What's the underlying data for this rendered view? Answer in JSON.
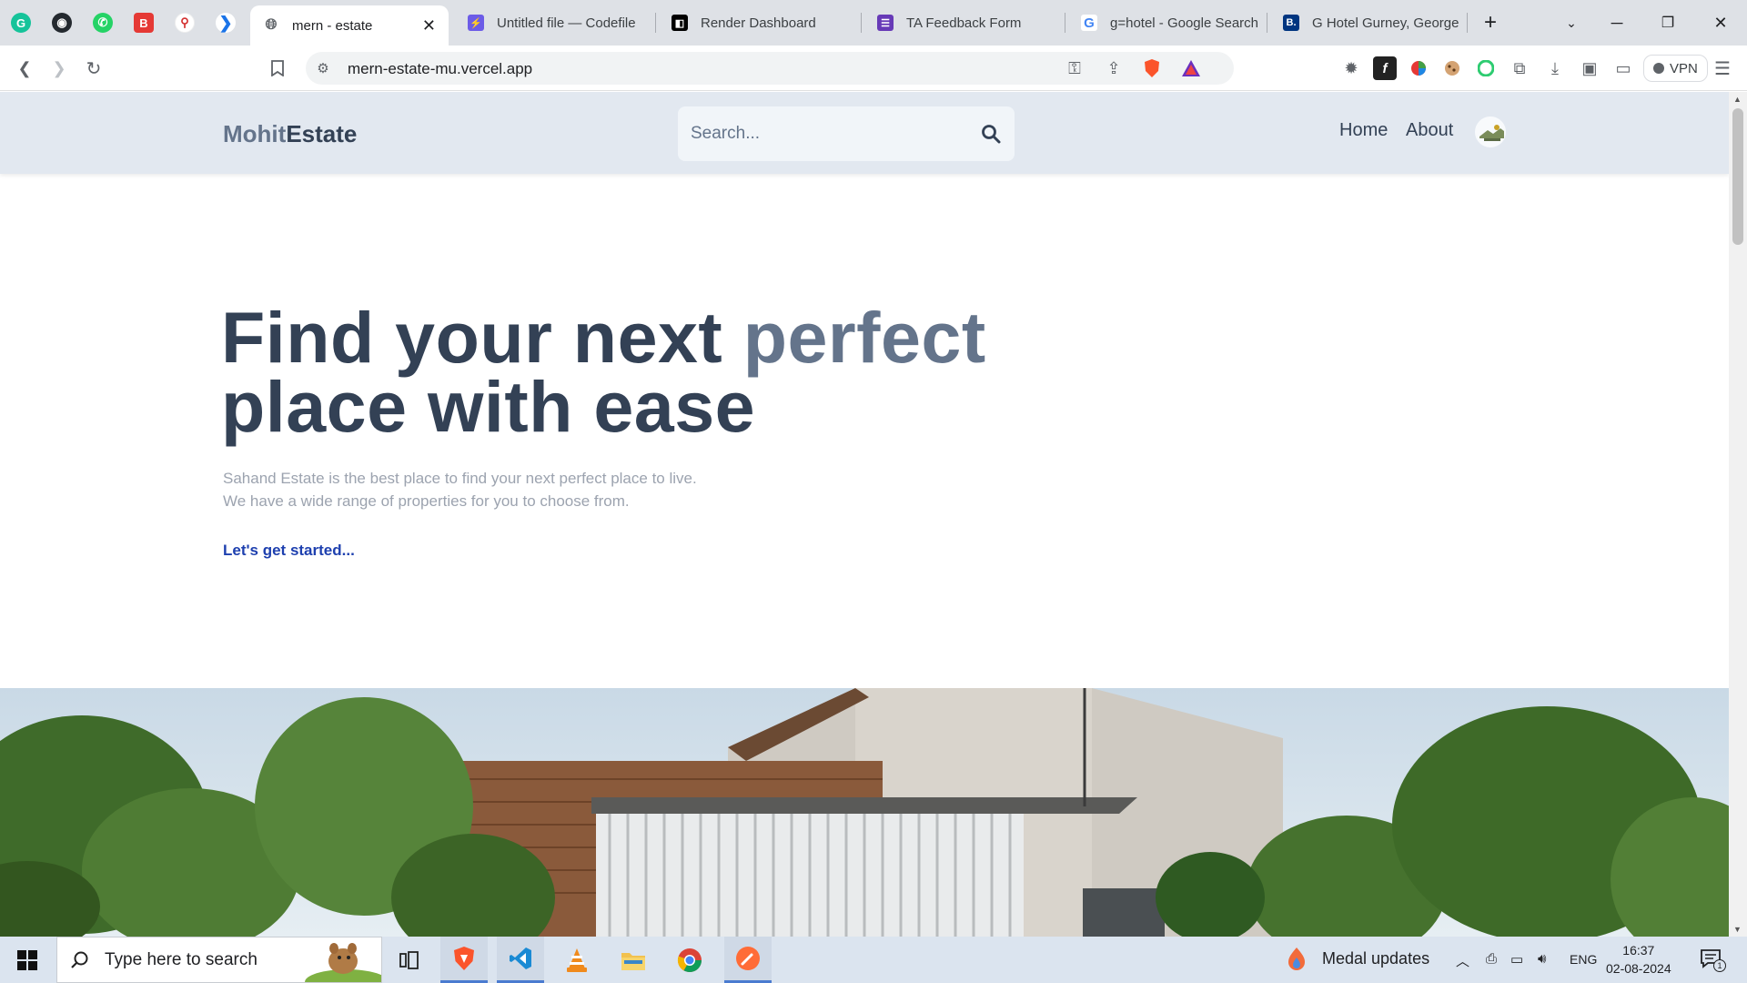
{
  "browser": {
    "tabs": [
      {
        "title": "mern - estate",
        "active": true,
        "favicon": "globe-icon"
      },
      {
        "title": "Untitled file — Codefile",
        "active": false,
        "favicon": "codefile-icon"
      },
      {
        "title": "Render Dashboard",
        "active": false,
        "favicon": "render-icon"
      },
      {
        "title": "TA Feedback Form",
        "active": false,
        "favicon": "forms-icon"
      },
      {
        "title": "g=hotel - Google Search",
        "active": false,
        "favicon": "google-icon"
      },
      {
        "title": "G Hotel Gurney, George",
        "active": false,
        "favicon": "booking-icon"
      }
    ],
    "address_bar": {
      "url": "mern-estate-mu.vercel.app"
    },
    "vpn_label": "VPN"
  },
  "site": {
    "logo": {
      "part1": "Mohit",
      "part2": "Estate"
    },
    "search": {
      "placeholder": "Search..."
    },
    "nav": {
      "home": "Home",
      "about": "About"
    },
    "hero": {
      "title_part1": "Find your next ",
      "title_highlight": "perfect",
      "title_part2": "place with ease",
      "subtitle_line1": "Sahand Estate is the best place to find your next perfect place to live.",
      "subtitle_line2": "We have a wide range of properties for you to choose from.",
      "cta": "Let's get started..."
    }
  },
  "taskbar": {
    "search_placeholder": "Type here to search",
    "news": "Medal updates",
    "language": "ENG",
    "time": "16:37",
    "date": "02-08-2024",
    "notification_count": "1"
  },
  "colors": {
    "site_header_bg": "#e2e8f0",
    "title_dark": "#334155",
    "title_highlight": "#64748b",
    "cta": "#1e40af",
    "subtitle": "#9ca3af"
  }
}
